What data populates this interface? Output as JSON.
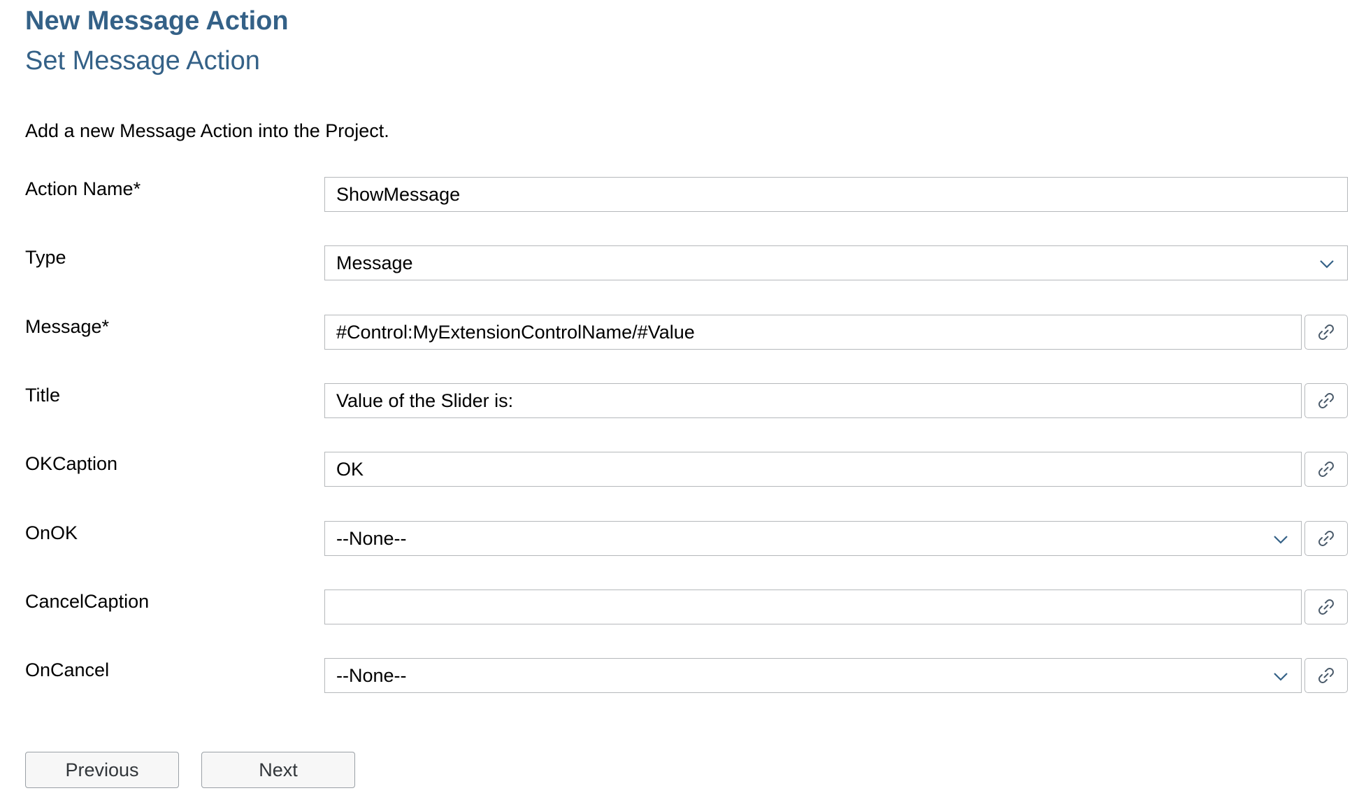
{
  "header": {
    "title": "New Message Action",
    "subtitle": "Set Message Action"
  },
  "description": "Add a new Message Action into the Project.",
  "fields": {
    "action_name": {
      "label": "Action Name*",
      "value": "ShowMessage"
    },
    "type": {
      "label": "Type",
      "value": "Message"
    },
    "message": {
      "label": "Message*",
      "value": "#Control:MyExtensionControlName/#Value"
    },
    "title": {
      "label": "Title",
      "value": "Value of the Slider is:"
    },
    "ok_caption": {
      "label": "OKCaption",
      "value": "OK"
    },
    "on_ok": {
      "label": "OnOK",
      "value": "--None--"
    },
    "cancel_caption": {
      "label": "CancelCaption",
      "value": ""
    },
    "on_cancel": {
      "label": "OnCancel",
      "value": "--None--"
    }
  },
  "buttons": {
    "previous": "Previous",
    "next": "Next"
  },
  "icons": {
    "dropdown": "chevron-down-icon",
    "binding": "link-icon"
  },
  "colors": {
    "heading": "#346187",
    "border": "#b5b8bb",
    "text": "#000000"
  }
}
